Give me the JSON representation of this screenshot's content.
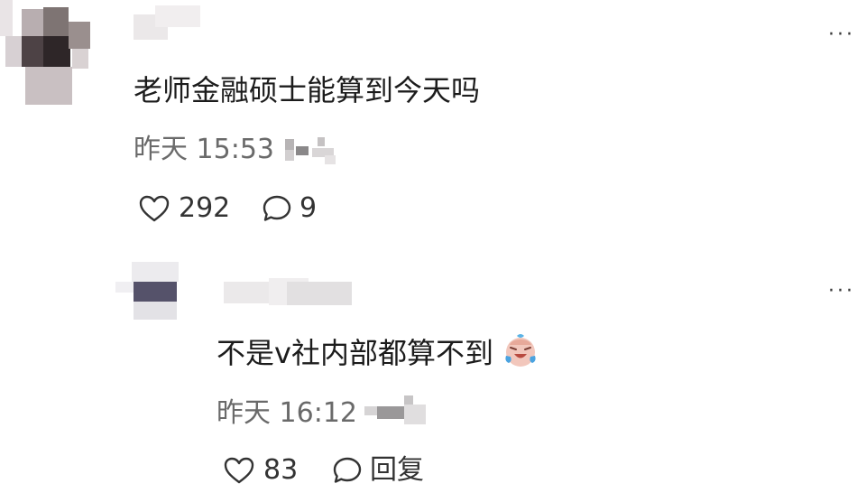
{
  "comments": [
    {
      "text": "老师金融硕士能算到今天吗",
      "time": "昨天 15:53",
      "likes": "292",
      "replies": "9"
    },
    {
      "text": "不是v社内部都算不到",
      "emoji": "crying-laughing-face-icon",
      "time": "昨天 16:12",
      "likes": "83",
      "reply_label": "回复"
    }
  ]
}
